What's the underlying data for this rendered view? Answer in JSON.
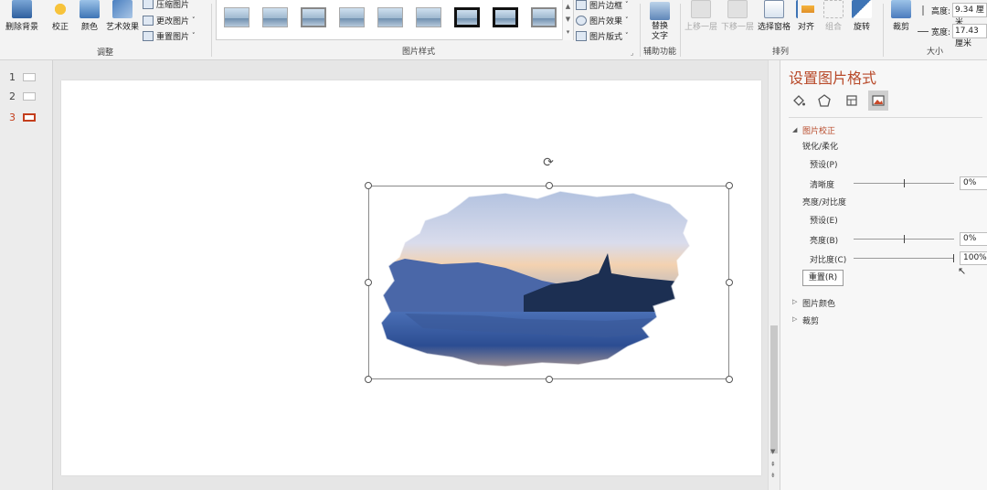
{
  "ribbon": {
    "adjust_group": {
      "label": "调整",
      "remove_bg": "删除背景",
      "corrections": "校正",
      "color": "颜色",
      "artistic": "艺术效果",
      "compress": "压缩图片",
      "change": "更改图片",
      "reset": "重置图片"
    },
    "styles_group": {
      "label": "图片样式"
    },
    "styles_side": {
      "border": "图片边框",
      "effects": "图片效果",
      "layout": "图片版式"
    },
    "accessibility_group": {
      "label": "辅助功能",
      "alt_text": "替换文字"
    },
    "arrange_group": {
      "label": "排列",
      "bring_forward": "上移一层",
      "send_backward": "下移一层",
      "selection_pane": "选择窗格",
      "align": "对齐",
      "group": "组合",
      "rotate": "旋转"
    },
    "size_group": {
      "label": "大小",
      "crop": "裁剪",
      "height_label": "高度:",
      "height_value": "9.34 厘米",
      "width_label": "宽度:",
      "width_value": "17.43 厘米"
    }
  },
  "slides": [
    {
      "num": "1"
    },
    {
      "num": "2"
    },
    {
      "num": "3"
    }
  ],
  "pane": {
    "title": "设置图片格式",
    "section_correction": "图片校正",
    "sharpen_soften": "锐化/柔化",
    "presets_1": "预设(P)",
    "sharpness": "清晰度",
    "sharpness_value": "0%",
    "brightness_contrast": "亮度/对比度",
    "presets_2": "预设(E)",
    "brightness": "亮度(B)",
    "brightness_value": "0%",
    "contrast": "对比度(C)",
    "contrast_value": "100%",
    "reset": "重置(R)",
    "section_color": "图片颜色",
    "section_crop": "裁剪"
  },
  "colors": {
    "accent": "#b84a2a",
    "sky": "#c9d4e6",
    "lake": "#3b5fa8"
  },
  "slider_levels": {
    "sharpness": 0.5,
    "brightness": 0.5,
    "contrast": 1.0
  }
}
